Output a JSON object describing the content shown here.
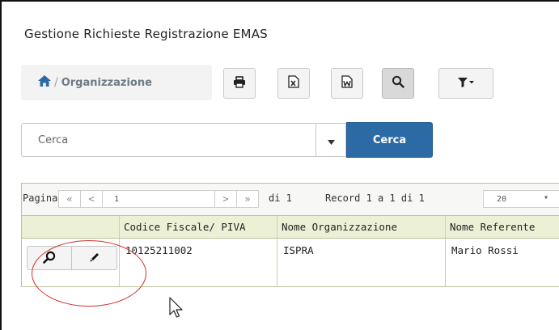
{
  "page": {
    "title": "Gestione Richieste Registrazione EMAS"
  },
  "breadcrumb": {
    "separator": "/",
    "current": "Organizzazione",
    "home_icon": "home-icon"
  },
  "toolbar": {
    "buttons": [
      {
        "name": "print",
        "icon": "print-icon"
      },
      {
        "name": "export-excel",
        "icon": "excel-icon"
      },
      {
        "name": "export-word",
        "icon": "word-icon"
      },
      {
        "name": "search",
        "icon": "search-icon",
        "active": true
      },
      {
        "name": "filter",
        "icon": "filter-icon"
      }
    ]
  },
  "search": {
    "placeholder": "Cerca",
    "button_label": "Cerca"
  },
  "pager": {
    "page_label": "Pagina",
    "first": "«",
    "prev": "<",
    "current_page": "1",
    "next": ">",
    "last": "»",
    "of_pages": "di 1",
    "records": "Record 1 a 1 di 1",
    "per_page": "20",
    "per_page_caret": "▾"
  },
  "table": {
    "columns": [
      "Codice Fiscale/ PIVA",
      "Nome Organizzazione",
      "Nome Referente"
    ],
    "rows": [
      {
        "codice_fiscale": "10125211002",
        "nome_organizzazione": "ISPRA",
        "nome_referente": "Mario Rossi"
      }
    ]
  },
  "colors": {
    "primary_button": "#2c6aa6",
    "grid_header": "#ecf1d6",
    "grid_border": "#b8c39a",
    "annotation_circle": "#d0322d"
  }
}
